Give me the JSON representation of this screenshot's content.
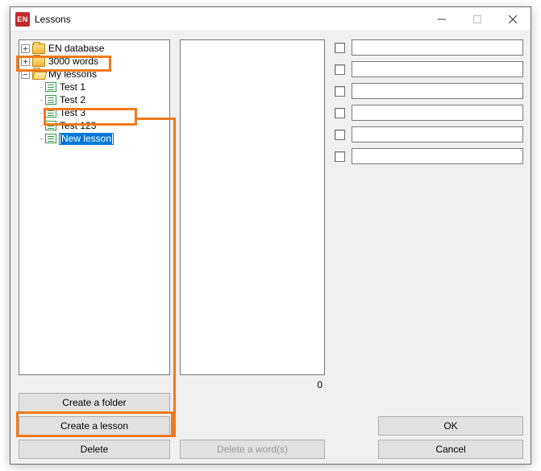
{
  "window": {
    "badge": "EN",
    "title": "Lessons"
  },
  "tree": {
    "root0": "EN database",
    "root1": "3000 words",
    "root2": "My lessons",
    "child0": "Test 1",
    "child1": "Test 2",
    "child2": "Test 3",
    "child3": "Test 123",
    "editing": "New lesson"
  },
  "count": "0",
  "buttons": {
    "createFolder": "Create a folder",
    "createLesson": "Create a lesson",
    "delete": "Delete",
    "deleteWords": "Delete a word(s)",
    "ok": "OK",
    "cancel": "Cancel"
  }
}
